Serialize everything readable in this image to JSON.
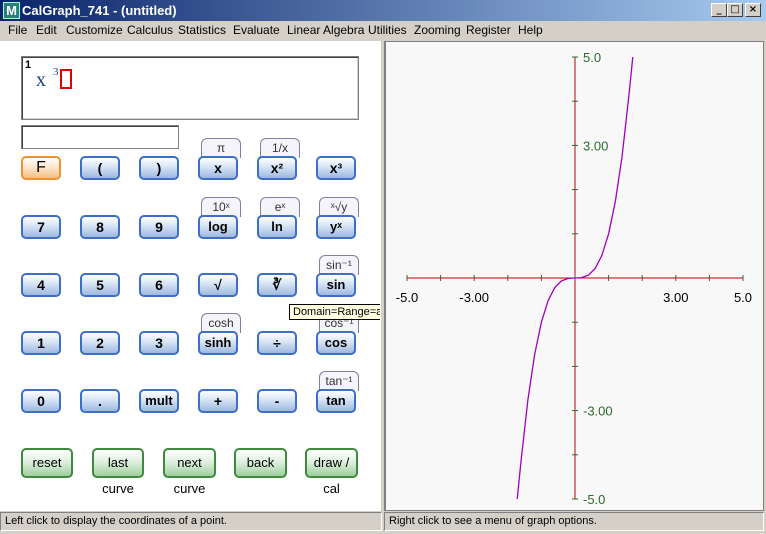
{
  "window": {
    "title": "CalGraph_741 - (untitled)",
    "icon_letter": "M",
    "minimize": "_",
    "maximize": "□",
    "close": "×"
  },
  "menu": [
    "File",
    "Edit",
    "Customize",
    "Calculus",
    "Statistics",
    "Evaluate",
    "Linear Algebra",
    "Utilities",
    "Zooming",
    "Register",
    "Help"
  ],
  "expression": {
    "line_number": "1",
    "base": "x",
    "exponent": "3"
  },
  "keypad": {
    "row1": [
      "F",
      "(",
      ")",
      "x",
      "x²",
      "x³"
    ],
    "row1_tabs": {
      "x": "π",
      "x2": "1/x"
    },
    "row2": [
      "7",
      "8",
      "9",
      "log",
      "ln",
      "yˣ"
    ],
    "row2_tabs": {
      "log": "10ˣ",
      "ln": "eˣ",
      "yx": "ˣ√y"
    },
    "row3": [
      "4",
      "5",
      "6",
      "√",
      "∛",
      "sin"
    ],
    "row3_tabs": {
      "sin": "sin⁻¹"
    },
    "row4": [
      "1",
      "2",
      "3",
      "sinh",
      "÷",
      "cos"
    ],
    "row4_tabs": {
      "sinh": "cosh",
      "cos": "cos⁻¹"
    },
    "row5": [
      "0",
      ".",
      "mult",
      "+",
      "-",
      "tan"
    ],
    "row5_tabs": {
      "tan": "tan⁻¹"
    },
    "actions": [
      "reset",
      "last curve",
      "next curve",
      "back",
      "draw / cal"
    ]
  },
  "tooltip": "Domain=Range=all",
  "status": {
    "left": "Left click to display the coordinates of a point.",
    "right": "Right click to see a menu of graph options."
  },
  "chart_data": {
    "type": "line",
    "function": "x^3",
    "series": [
      {
        "values": [
          [
            -1.72,
            -5.0
          ],
          [
            -1.6,
            -4.096
          ],
          [
            -1.4,
            -2.744
          ],
          [
            -1.2,
            -1.728
          ],
          [
            -1.0,
            -1.0
          ],
          [
            -0.8,
            -0.512
          ],
          [
            -0.6,
            -0.216
          ],
          [
            -0.4,
            -0.064
          ],
          [
            -0.2,
            -0.008
          ],
          [
            0,
            0
          ],
          [
            0.2,
            0.008
          ],
          [
            0.4,
            0.064
          ],
          [
            0.6,
            0.216
          ],
          [
            0.8,
            0.512
          ],
          [
            1.0,
            1.0
          ],
          [
            1.2,
            1.728
          ],
          [
            1.4,
            2.744
          ],
          [
            1.6,
            4.096
          ],
          [
            1.72,
            5.0
          ]
        ]
      }
    ],
    "xlim": [
      -5.0,
      5.0
    ],
    "ylim": [
      -5.0,
      5.0
    ],
    "xticks": [
      "-5.0",
      "-3.00",
      "3.00",
      "5.0"
    ],
    "yticks": [
      "5.0",
      "3.00",
      "-3.00",
      "-5.0"
    ],
    "xtick_values": [
      -5.0,
      -3.0,
      3.0,
      5.0
    ],
    "ytick_values": [
      5.0,
      3.0,
      -3.0,
      -5.0
    ],
    "axis_color": "#c00000",
    "curve_color": "#a000c0",
    "grid": false
  }
}
